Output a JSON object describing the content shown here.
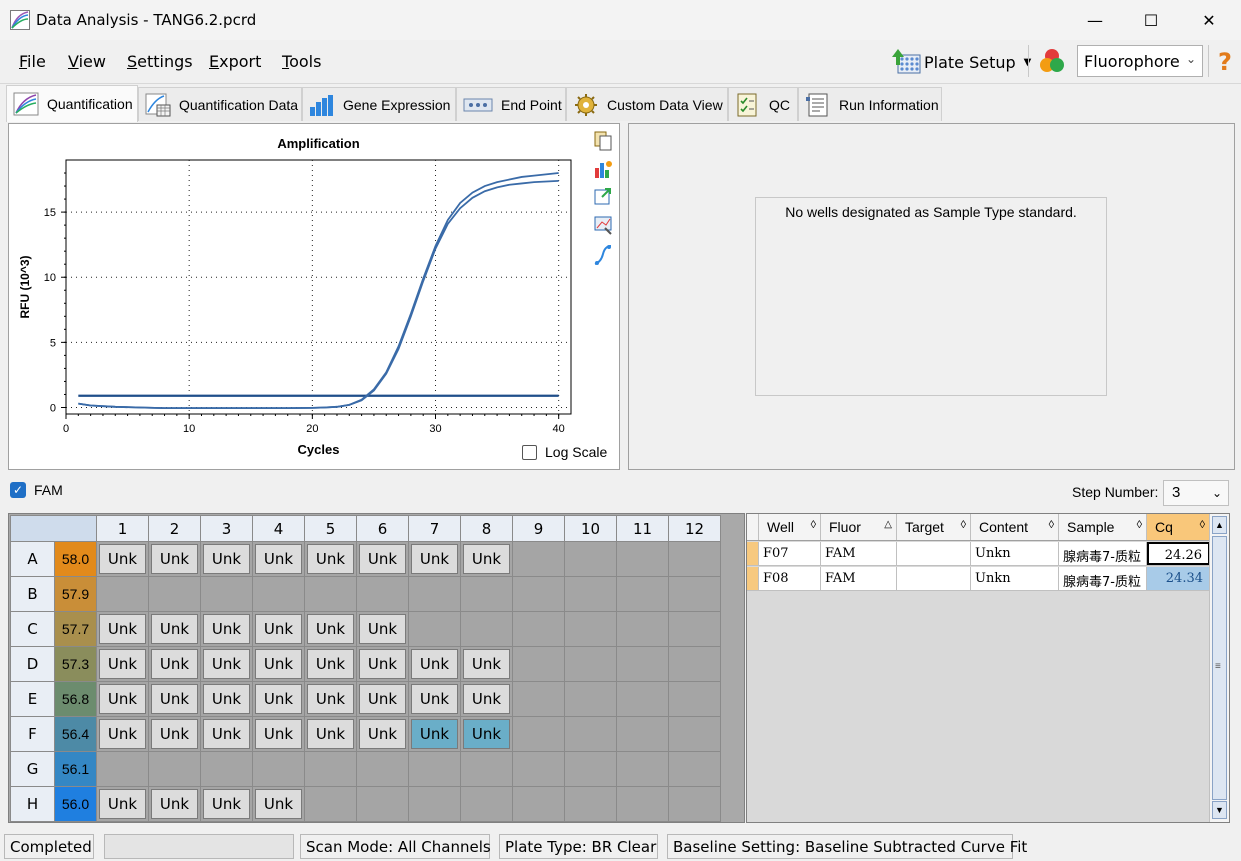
{
  "window": {
    "title": "Data Analysis - TANG6.2.pcrd",
    "minimize": "—",
    "maximize": "☐",
    "close": "✕"
  },
  "menu": {
    "file": "File",
    "view": "View",
    "settings": "Settings",
    "export": "Export",
    "tools": "Tools"
  },
  "toolbar": {
    "plate_setup": "Plate Setup",
    "fluorophore": "Fluorophore"
  },
  "tabs": [
    "Quantification",
    "Quantification Data",
    "Gene Expression",
    "End Point",
    "Custom Data View",
    "QC",
    "Run Information"
  ],
  "chart_data": {
    "type": "line",
    "title": "Amplification",
    "xlabel": "Cycles",
    "ylabel": "RFU (10^3)",
    "xlim": [
      0,
      41
    ],
    "ylim": [
      -0.5,
      19
    ],
    "xticks": [
      0,
      10,
      20,
      30,
      40
    ],
    "yticks": [
      0,
      5,
      10,
      15
    ],
    "grid": true,
    "threshold": 0.9,
    "series": [
      {
        "x": [
          1,
          2,
          4,
          6,
          8,
          10,
          12,
          14,
          16,
          18,
          20,
          21,
          22,
          23,
          24,
          25,
          26,
          27,
          28,
          29,
          30,
          31,
          32,
          33,
          34,
          35,
          36,
          37,
          38,
          40
        ],
        "values": [
          0.3,
          0.15,
          0.05,
          0.0,
          -0.05,
          -0.05,
          -0.05,
          -0.05,
          -0.05,
          -0.05,
          -0.03,
          0.0,
          0.05,
          0.2,
          0.6,
          1.4,
          2.7,
          4.7,
          7.2,
          9.9,
          12.4,
          14.4,
          15.7,
          16.5,
          17.0,
          17.3,
          17.5,
          17.7,
          17.8,
          18.0
        ]
      },
      {
        "x": [
          1,
          2,
          4,
          6,
          8,
          10,
          12,
          14,
          16,
          18,
          20,
          21,
          22,
          23,
          24,
          25,
          26,
          27,
          28,
          29,
          30,
          31,
          32,
          33,
          34,
          35,
          36,
          37,
          38,
          40
        ],
        "values": [
          0.3,
          0.15,
          0.05,
          0.0,
          -0.05,
          -0.05,
          -0.05,
          -0.05,
          -0.05,
          -0.05,
          -0.03,
          0.0,
          0.05,
          0.2,
          0.55,
          1.3,
          2.6,
          4.5,
          7.0,
          9.7,
          12.2,
          14.1,
          15.3,
          16.1,
          16.6,
          16.9,
          17.1,
          17.2,
          17.3,
          17.4
        ]
      }
    ]
  },
  "log_scale_label": "Log Scale",
  "std_message": "No wells designated as Sample Type standard.",
  "fam_label": "FAM",
  "step_label": "Step Number:",
  "step_value": "3",
  "plate": {
    "columns": [
      "1",
      "2",
      "3",
      "4",
      "5",
      "6",
      "7",
      "8",
      "9",
      "10",
      "11",
      "12"
    ],
    "rows": [
      {
        "label": "A",
        "temp": "58.0",
        "tempColor": "#e28a1b",
        "wells": 8,
        "selected": []
      },
      {
        "label": "B",
        "temp": "57.9",
        "tempColor": "#c98e38",
        "wells": 0,
        "selected": []
      },
      {
        "label": "C",
        "temp": "57.7",
        "tempColor": "#a98f4d",
        "wells": 6,
        "selected": []
      },
      {
        "label": "D",
        "temp": "57.3",
        "tempColor": "#8a8d5c",
        "wells": 8,
        "selected": []
      },
      {
        "label": "E",
        "temp": "56.8",
        "tempColor": "#6c8c6e",
        "wells": 8,
        "selected": []
      },
      {
        "label": "F",
        "temp": "56.4",
        "tempColor": "#4d8aa6",
        "wells": 8,
        "selected": [
          7,
          8
        ]
      },
      {
        "label": "G",
        "temp": "56.1",
        "tempColor": "#3487c4",
        "wells": 0,
        "selected": []
      },
      {
        "label": "H",
        "temp": "56.0",
        "tempColor": "#1f7fe0",
        "wells": 4,
        "selected": []
      }
    ],
    "well_label": "Unk"
  },
  "table": {
    "headers": [
      "Well",
      "Fluor",
      "Target",
      "Content",
      "Sample",
      "Cq"
    ],
    "rows": [
      {
        "well": "F07",
        "fluor": "FAM",
        "target": "",
        "content": "Unkn",
        "sample": "腺病毒7-质粒",
        "cq": "24.26"
      },
      {
        "well": "F08",
        "fluor": "FAM",
        "target": "",
        "content": "Unkn",
        "sample": "腺病毒7-质粒",
        "cq": "24.34"
      }
    ]
  },
  "status": {
    "state": "Completed",
    "scan_mode": "Scan Mode: All Channels",
    "plate_type": "Plate Type: BR Clear",
    "baseline": "Baseline Setting: Baseline Subtracted Curve Fit"
  }
}
